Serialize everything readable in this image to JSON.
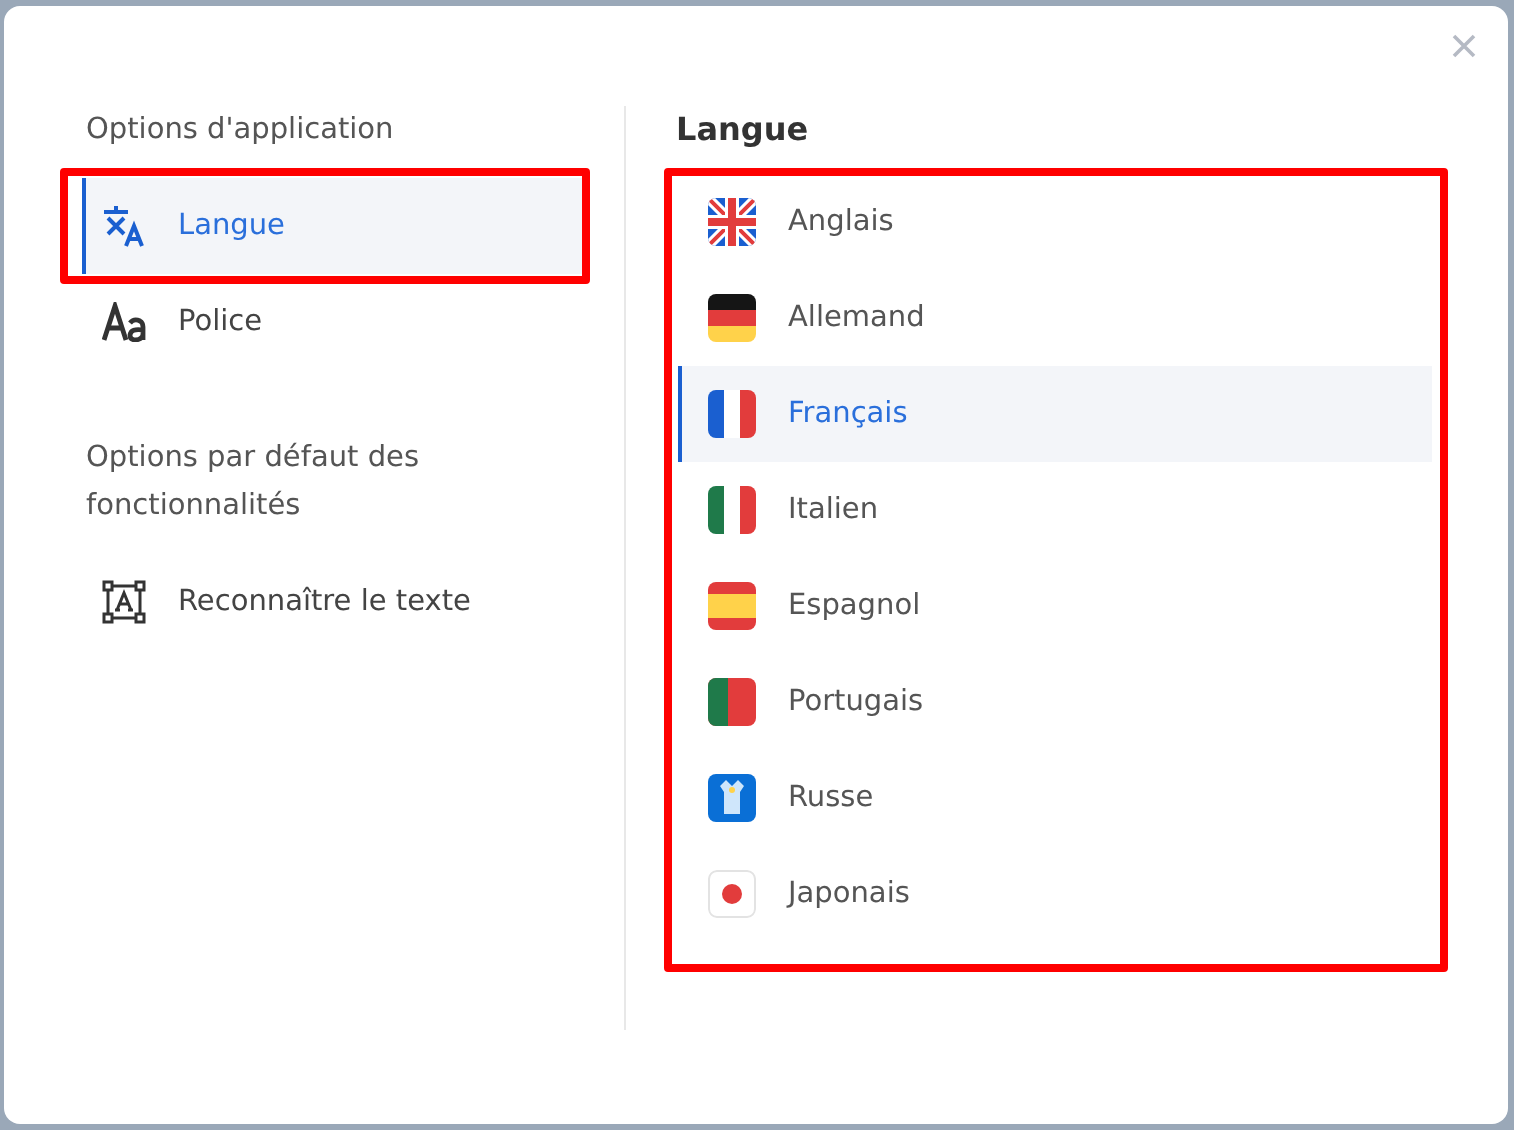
{
  "sidebar": {
    "sections": [
      {
        "title": "Options d'application",
        "items": [
          {
            "label": "Langue",
            "selected": true,
            "highlighted": true
          },
          {
            "label": "Police",
            "selected": false,
            "highlighted": false
          }
        ]
      },
      {
        "title": "Options par défaut des fonctionnalités",
        "items": [
          {
            "label": "Reconnaître le texte",
            "selected": false,
            "highlighted": false
          }
        ]
      }
    ]
  },
  "language_panel": {
    "title": "Langue",
    "highlighted": true,
    "languages": [
      {
        "label": "Anglais",
        "selected": false
      },
      {
        "label": "Allemand",
        "selected": false
      },
      {
        "label": "Français",
        "selected": true
      },
      {
        "label": "Italien",
        "selected": false
      },
      {
        "label": "Espagnol",
        "selected": false
      },
      {
        "label": "Portugais",
        "selected": false
      },
      {
        "label": "Russe",
        "selected": false
      },
      {
        "label": "Japonais",
        "selected": false
      }
    ]
  }
}
